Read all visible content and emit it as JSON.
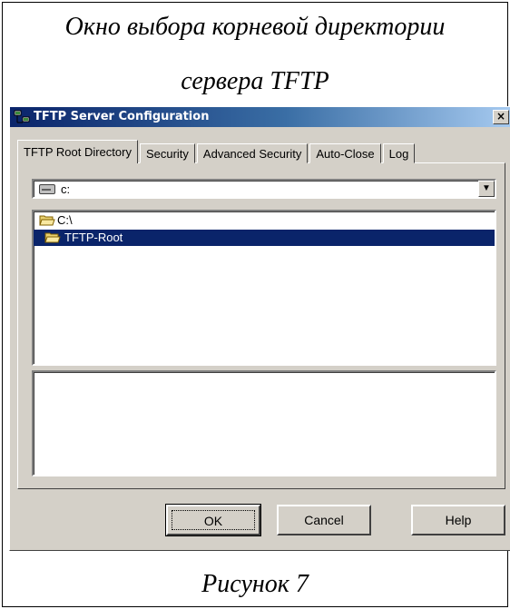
{
  "captions": {
    "top_line1": "Окно выбора корневой директории",
    "top_line2": "сервера TFTP",
    "bottom": "Рисунок 7"
  },
  "window": {
    "title": "TFTP Server Configuration",
    "close_label": "×",
    "title_icon": "network-computer-icon"
  },
  "tabs": [
    {
      "label": "TFTP Root Directory",
      "active": true
    },
    {
      "label": "Security",
      "active": false
    },
    {
      "label": "Advanced Security",
      "active": false
    },
    {
      "label": "Auto-Close",
      "active": false
    },
    {
      "label": "Log",
      "active": false
    }
  ],
  "drive_select": {
    "value": "c:",
    "icon": "drive-icon",
    "arrow": "▼"
  },
  "directory_list": [
    {
      "label": "C:\\",
      "icon": "open-folder-icon",
      "selected": false
    },
    {
      "label": "TFTP-Root",
      "icon": "open-folder-icon",
      "selected": true
    }
  ],
  "buttons": {
    "ok": "OK",
    "cancel": "Cancel",
    "help": "Help"
  },
  "colors": {
    "titlebar": "#0a246a",
    "selection": "#0a246a",
    "dialog_face": "#d4d0c8"
  }
}
